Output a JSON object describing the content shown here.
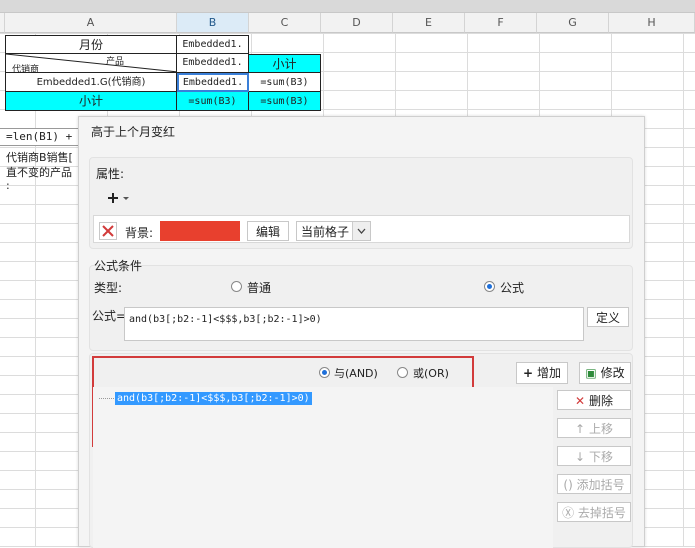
{
  "columns": [
    "A",
    "B",
    "C",
    "D",
    "E",
    "F",
    "G",
    "H"
  ],
  "sheet": {
    "month_header": "月份",
    "product_header": "产品",
    "dealer_header": "代销商",
    "b_row1": "Embedded1.",
    "b_row2": "Embedded1.",
    "b_row3": "Embedded1.",
    "subtotal_c": "小计",
    "a_row3": "Embedded1.G(代销商)",
    "c_row3": "=sum(B3)",
    "subtotal_a": "小计",
    "b_row4": "=sum(B3)",
    "c_row4": "=sum(B3)",
    "formula_bar": "=len(B1) + '",
    "note_line1": "代销商B销售[",
    "note_line2": "直不变的产品",
    "note_line3": ":"
  },
  "dialog": {
    "title": "高于上个月变红",
    "attributes_label": "属性:",
    "add_icon": "plus-icon",
    "remove_icon": "close-icon",
    "background_label": "背景:",
    "background_color": "#e8402e",
    "edit_button": "编辑",
    "scope_select": "当前格子",
    "condition_group_label": "公式条件",
    "type_label": "类型:",
    "radio_normal": "普通",
    "radio_formula": "公式",
    "formula_label": "公式=",
    "formula_value": "and(b3[;b2:-1]<$$$,b3[;b2:-1]>0)",
    "define_button": "定义",
    "radio_and": "与(AND)",
    "radio_or": "或(OR)",
    "add_button": "增加",
    "modify_button": "修改",
    "delete_button": "删除",
    "move_up_button": "上移",
    "move_down_button": "下移",
    "add_bracket_button": "添加括号",
    "remove_bracket_button": "去掉括号",
    "condition_item": "and(b3[;b2:-1]<$$$,b3[;b2:-1]>0)",
    "highlight_color": "#d23b3b"
  }
}
